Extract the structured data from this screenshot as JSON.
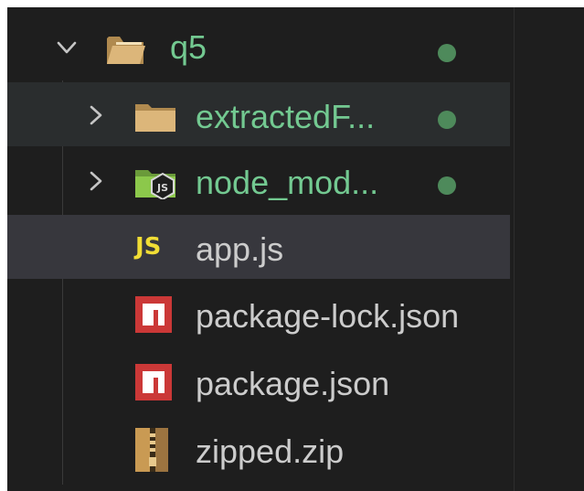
{
  "explorer": {
    "root": {
      "label": "q5",
      "icon": "folder-open-icon",
      "expanded": true,
      "status_dot": true
    },
    "items": [
      {
        "label": "extractedF...",
        "icon": "folder-icon",
        "type": "folder",
        "expanded": false,
        "modified": true
      },
      {
        "label": "node_mod...",
        "icon": "node-folder-icon",
        "type": "folder",
        "expanded": false,
        "modified": true
      },
      {
        "label": "app.js",
        "icon": "js-file-icon",
        "icon_text": "JS",
        "type": "file",
        "selected": true
      },
      {
        "label": "package-lock.json",
        "icon": "npm-icon",
        "type": "file"
      },
      {
        "label": "package.json",
        "icon": "npm-icon",
        "type": "file"
      },
      {
        "label": "zipped.zip",
        "icon": "zip-icon",
        "type": "file"
      }
    ]
  },
  "colors": {
    "background": "#1e1e1e",
    "hover_row": "#2a2d2e",
    "selected_row": "#37373d",
    "text": "#cccccc",
    "modified_text": "#73c991",
    "status_dot": "#4e8a5b",
    "folder": "#dcb67a",
    "js": "#f1dd35",
    "npm": "#cb3837",
    "node_green": "#8cc84b"
  }
}
